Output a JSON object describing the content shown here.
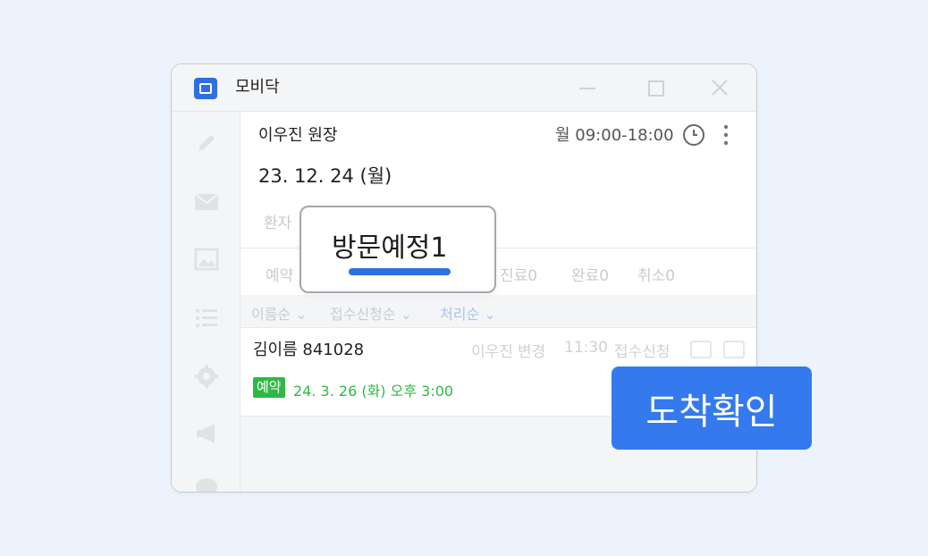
{
  "window": {
    "title": "모비닥"
  },
  "header": {
    "doctor": "이우진 원장",
    "hours": "월 09:00-18:00",
    "date": "23. 12. 24 (월)",
    "faded_label": "환자"
  },
  "tabs": [
    {
      "label": "예약"
    },
    {
      "label": "진료0"
    },
    {
      "label": "완료0"
    },
    {
      "label": "취소0"
    }
  ],
  "sort": {
    "name": "이름순",
    "received": "접수신청순",
    "processed": "처리순"
  },
  "patient": {
    "name": "김이름 841028",
    "doctor": "이우진",
    "change": "변경",
    "time": "11:30",
    "status": "접수신청",
    "badge": "예약",
    "appointment": "24. 3. 26 (화) 오후 3:00"
  },
  "popup": {
    "label": "방문예정1"
  },
  "action": {
    "label": "도착확인"
  },
  "colors": {
    "accent": "#3479ee",
    "brand": "#2f6fe4",
    "appointment_green": "#2fb844",
    "background": "#edf3fc"
  },
  "icons": {
    "app": "mobidoc-logo-icon",
    "sidebar": [
      "pencil-icon",
      "mail-icon",
      "image-icon",
      "list-icon",
      "gear-icon",
      "megaphone-icon",
      "chat-icon"
    ],
    "header": [
      "clock-icon",
      "more-vertical-icon"
    ]
  }
}
